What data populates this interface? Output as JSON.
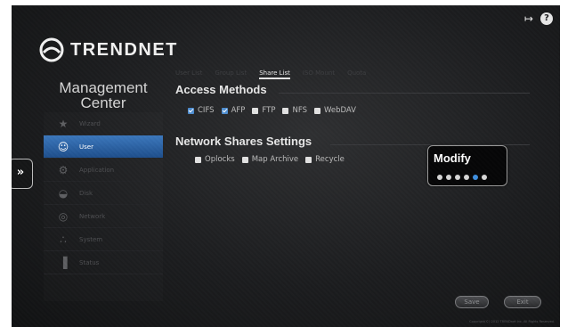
{
  "brand": {
    "name": "TRENDNET"
  },
  "management_title": {
    "line1": "Management",
    "line2": "Center"
  },
  "top_icons": [
    {
      "icon": "logout-icon"
    },
    {
      "icon": "help-icon",
      "glyph": "?"
    }
  ],
  "sidebar": {
    "items": [
      {
        "label": "Wizard",
        "icon": "wand-icon",
        "active": false
      },
      {
        "label": "User",
        "icon": "user-icon",
        "active": true
      },
      {
        "label": "Application",
        "icon": "application-icon",
        "active": false
      },
      {
        "label": "Disk",
        "icon": "disk-icon",
        "active": false
      },
      {
        "label": "Network",
        "icon": "network-icon",
        "active": false
      },
      {
        "label": "System",
        "icon": "system-icon",
        "active": false
      },
      {
        "label": "Status",
        "icon": "status-icon",
        "active": false
      }
    ]
  },
  "tabs": [
    {
      "label": "User List",
      "active": false
    },
    {
      "label": "Group List",
      "active": false
    },
    {
      "label": "Share List",
      "active": true
    },
    {
      "label": "ISO Mount",
      "active": false
    },
    {
      "label": "Quota",
      "active": false
    }
  ],
  "access_methods": {
    "title": "Access Methods",
    "options": [
      {
        "label": "CIFS",
        "checked": true
      },
      {
        "label": "AFP",
        "checked": true
      },
      {
        "label": "FTP",
        "checked": false
      },
      {
        "label": "NFS",
        "checked": false
      },
      {
        "label": "WebDAV",
        "checked": false
      }
    ]
  },
  "share_settings": {
    "title": "Network Shares Settings",
    "options": [
      {
        "label": "Oplocks",
        "checked": false
      },
      {
        "label": "Map Archive",
        "checked": false
      },
      {
        "label": "Recycle",
        "checked": false
      }
    ]
  },
  "modify_popup": {
    "title": "Modify",
    "dot_count": 6,
    "active_dot": 5
  },
  "buttons": {
    "save": "Save",
    "exit": "Exit"
  },
  "footer": {
    "copyright": "Copyright(©) 2012 TRENDnet Inc. All Rights Reserved."
  },
  "colors": {
    "accent": "#2f6bb3",
    "background": "#1c1d1f"
  }
}
